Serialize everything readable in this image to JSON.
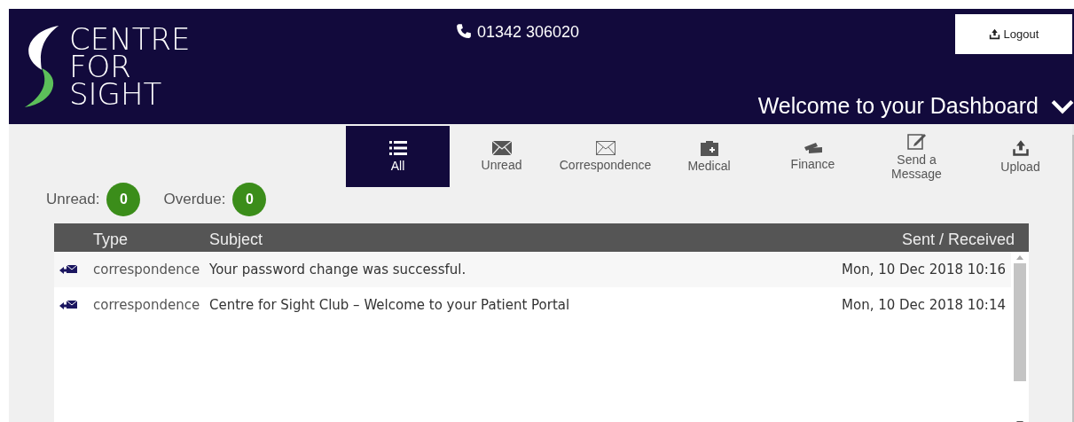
{
  "header": {
    "logo_lines": [
      "CENTRE",
      "FOR",
      "SIGHT"
    ],
    "phone": "01342 306020",
    "logout": "Logout",
    "welcome": "Welcome to your Dashboard"
  },
  "tabs": [
    {
      "label": "All",
      "kind": "list",
      "selected": true
    },
    {
      "label": "Unread",
      "kind": "envelope-solid",
      "selected": false
    },
    {
      "label": "Correspondence",
      "kind": "envelope",
      "selected": false
    },
    {
      "label": "Medical",
      "kind": "medical",
      "selected": false
    },
    {
      "label": "Finance",
      "kind": "cards",
      "selected": false
    },
    {
      "label": "Send a Message",
      "kind": "compose",
      "selected": false
    },
    {
      "label": "Upload",
      "kind": "upload",
      "selected": false
    }
  ],
  "counters": [
    {
      "label": "Unread:",
      "count": "0"
    },
    {
      "label": "Overdue:",
      "count": "0"
    }
  ],
  "table": {
    "columns": [
      "Type",
      "Subject",
      "Sent / Received"
    ],
    "rows": [
      {
        "type": "correspondence",
        "subject": "Your password change was successful.",
        "date": "Mon, 10 Dec 2018 10:16"
      },
      {
        "type": "correspondence",
        "subject": "Centre for Sight Club – Welcome to your Patient Portal",
        "date": "Mon, 10 Dec 2018 10:14"
      }
    ]
  }
}
